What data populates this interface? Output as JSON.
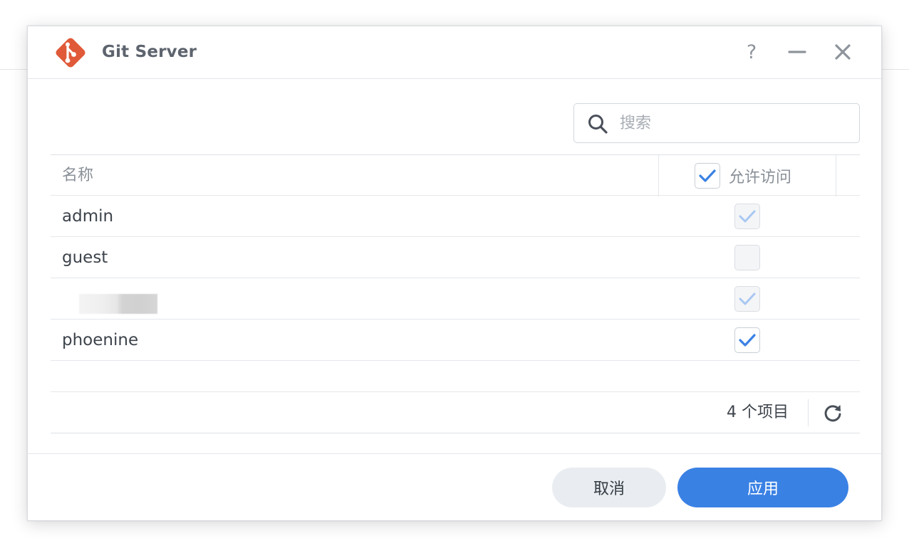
{
  "window": {
    "title": "Git Server",
    "help_label": "?"
  },
  "search": {
    "placeholder": "搜索",
    "value": ""
  },
  "grid": {
    "columns": {
      "name": "名称",
      "access": "允许访问"
    },
    "header_select_all_checked": true,
    "rows": [
      {
        "name": "admin",
        "access": true,
        "disabled": true
      },
      {
        "name": "guest",
        "access": false,
        "disabled": true
      },
      {
        "name": "",
        "access": true,
        "disabled": true,
        "redacted": true
      },
      {
        "name": "phoenine",
        "access": true,
        "disabled": false
      }
    ]
  },
  "status": {
    "item_count": "4 个项目"
  },
  "buttons": {
    "cancel": "取消",
    "apply": "应用"
  },
  "colors": {
    "accent": "#3a81e4",
    "check_disabled": "#a9c8f2",
    "logo": "#e05a39"
  }
}
